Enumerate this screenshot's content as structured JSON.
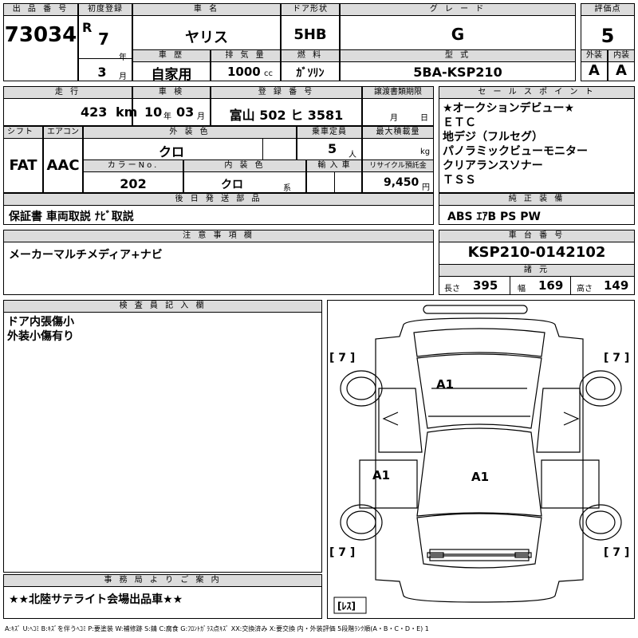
{
  "labels": {
    "lot_no": "出 品 番 号",
    "first_reg": "初度登録",
    "car_name": "車 名",
    "door": "ドア形状",
    "grade": "グ レ ー ド",
    "score": "評価点",
    "history": "車 歴",
    "displacement": "排 気 量",
    "fuel": "燃 料",
    "model": "型 式",
    "exterior": "外装",
    "interior": "内装",
    "mileage": "走 行",
    "inspection": "車 検",
    "reg_number": "登 録 番 号",
    "transfer_docs": "譲渡書類期限",
    "sales_point": "セ ー ル ス ポ イ ン ト",
    "shift": "シフト",
    "aircon": "エアコン",
    "ext_color": "外 装 色",
    "capacity": "乗車定員",
    "max_load": "最大積載量",
    "color_no": "カラーNo.",
    "int_color": "内 装 色",
    "import": "輸 入 車",
    "recycle": "リサイクル預託金",
    "later_parts": "後 日 発 送 部 品",
    "genuine_equip": "純 正 装 備",
    "notes": "注 意 事 項 欄",
    "chassis": "車 台 番 号",
    "specs": "諸 元",
    "inspector": "検 査 員 記 入 欄",
    "office": "事 務 局 よ り ご 案 内"
  },
  "vehicle": {
    "lot_number": "73034",
    "era_mark": "R",
    "year": "7",
    "year_unit": "年",
    "month": "3",
    "month_unit": "月",
    "car_name": "ヤリス",
    "door_type": "5HB",
    "grade": "G",
    "score": "5",
    "history": "自家用",
    "displacement": "1000",
    "displacement_unit": "cc",
    "fuel": "ｶﾞｿﾘﾝ",
    "model": "5BA-KSP210",
    "exterior_grade": "A",
    "interior_grade": "A",
    "mileage": "423",
    "mileage_unit": "km",
    "inspection_year": "10",
    "inspection_year_unit": "年",
    "inspection_month": "03",
    "inspection_month_unit": "月",
    "reg_number": "富山  502 ヒ 3581",
    "transfer_month_unit": "月",
    "transfer_day_unit": "日",
    "shift": "FAT",
    "aircon": "AAC",
    "ext_color": "クロ",
    "capacity": "5",
    "capacity_unit": "人",
    "max_load_unit": "kg",
    "color_no": "202",
    "int_color": "クロ",
    "int_color_unit": "系",
    "recycle_fee": "9,450",
    "recycle_unit": "円",
    "later_parts": "保証書  車両取説  ﾅﾋﾞ取説",
    "notes": "メーカーマルチメディア+ナビ",
    "chassis_number": "KSP210-0142102",
    "length_label": "長さ",
    "length": "395",
    "width_label": "幅",
    "width": "169",
    "height_label": "高さ",
    "height": "149",
    "genuine_equipment": "ABS  ｴｱB  PS  PW"
  },
  "sales_points": [
    "★オークションデビュー★",
    "ＥＴＣ",
    "地デジ（フルセグ）",
    "パノラミックビューモニター",
    "クリアランスソナー",
    "ＴＳＳ"
  ],
  "inspector_notes": [
    "ドア内張傷小",
    "外装小傷有り"
  ],
  "office_note": "★★北陸サテライト会場出品車★★",
  "diagram": {
    "tread_fl": "[ 7 ]",
    "tread_fr": "[ 7 ]",
    "tread_rl": "[ 7 ]",
    "tread_rr": "[ 7 ]",
    "spare": "[ﾚｽ]",
    "mark_roof": "A1",
    "mark_left_door": "A1",
    "mark_center": "A1"
  },
  "legend": "A:ｷｽﾞ  U:ﾍｺﾐ  B:ｷｽﾞを伴うﾍｺﾐ  P:要塗装  W:補修跡  S:錆  C:腐食  G:ﾌﾛﾝﾄｶﾞﾗｽ点ｷｽﾞ  XX:交換済み  X:要交換    内・外装評価  5段階ﾗﾝｸ順(A・B・C・D・E) 1"
}
